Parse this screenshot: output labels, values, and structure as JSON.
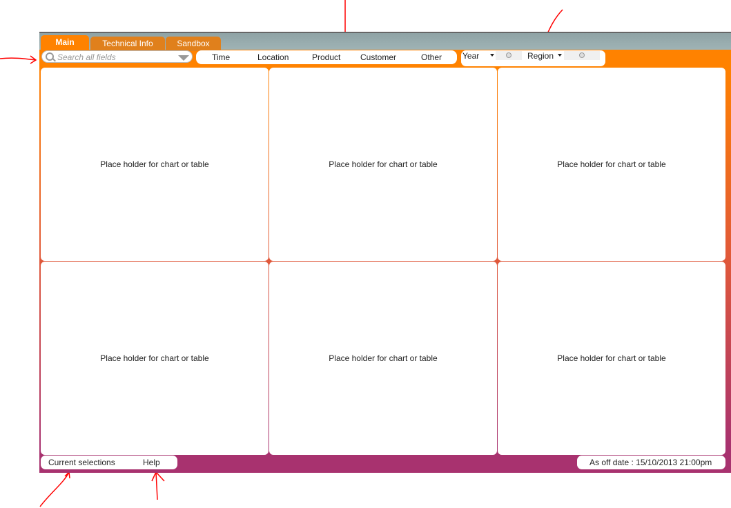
{
  "tabs": [
    {
      "label": "Main",
      "active": true
    },
    {
      "label": "Technical Info"
    },
    {
      "label": "Sandbox"
    }
  ],
  "search": {
    "placeholder": "Search all fields",
    "icon": "search-icon"
  },
  "dimensions": [
    "Time",
    "Location",
    "Product",
    "Customer",
    "Other"
  ],
  "filters": [
    {
      "label": "Year",
      "value": ""
    },
    {
      "label": "Region",
      "value": ""
    }
  ],
  "panels": [
    "Place holder for chart or table",
    "Place holder for chart or table",
    "Place holder for chart or table",
    "Place holder for chart or table",
    "Place holder for chart or table",
    "Place holder for chart or table"
  ],
  "footer": {
    "current_selections": "Current selections",
    "help": "Help",
    "as_of": "As off date : 15/10/2013 21:00pm"
  },
  "colors": {
    "accent": "#ff8200",
    "bottom": "#a8326f",
    "tabbar": "#9fb3b5",
    "annotation": "#ff0000"
  }
}
